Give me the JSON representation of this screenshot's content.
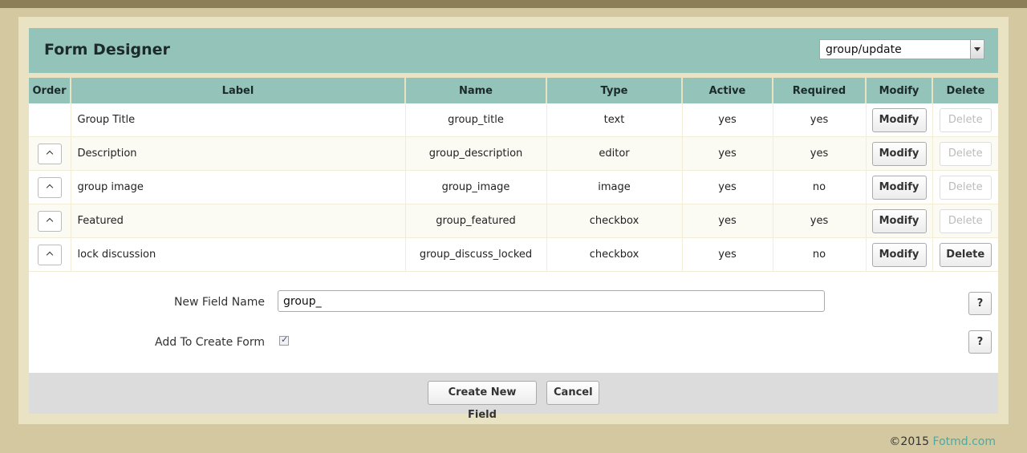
{
  "header": {
    "title": "Form Designer",
    "form_select_value": "group/update"
  },
  "table": {
    "columns": [
      "Order",
      "Label",
      "Name",
      "Type",
      "Active",
      "Required",
      "Modify",
      "Delete"
    ],
    "rows": [
      {
        "label": "Group Title",
        "name": "group_title",
        "type": "text",
        "active": "yes",
        "required": "yes",
        "modify": "Modify",
        "delete": "Delete"
      },
      {
        "label": "Description",
        "name": "group_description",
        "type": "editor",
        "active": "yes",
        "required": "yes",
        "modify": "Modify",
        "delete": "Delete"
      },
      {
        "label": "group image",
        "name": "group_image",
        "type": "image",
        "active": "yes",
        "required": "no",
        "modify": "Modify",
        "delete": "Delete"
      },
      {
        "label": "Featured",
        "name": "group_featured",
        "type": "checkbox",
        "active": "yes",
        "required": "yes",
        "modify": "Modify",
        "delete": "Delete"
      },
      {
        "label": "lock discussion",
        "name": "group_discuss_locked",
        "type": "checkbox",
        "active": "yes",
        "required": "no",
        "modify": "Modify",
        "delete": "Delete"
      }
    ]
  },
  "new_field": {
    "name_label": "New Field Name",
    "name_value": "group_",
    "add_to_create_label": "Add To Create Form",
    "add_to_create_checked": true,
    "help_label": "?"
  },
  "actions": {
    "create_label": "Create New Field",
    "cancel_label": "Cancel"
  },
  "footer": {
    "copyright": "©2015",
    "link": "Fotmd.com"
  },
  "colors": {
    "header_bg": "#93c3b9",
    "page_bg": "#d3c8a0",
    "link": "#4fa8a0"
  }
}
